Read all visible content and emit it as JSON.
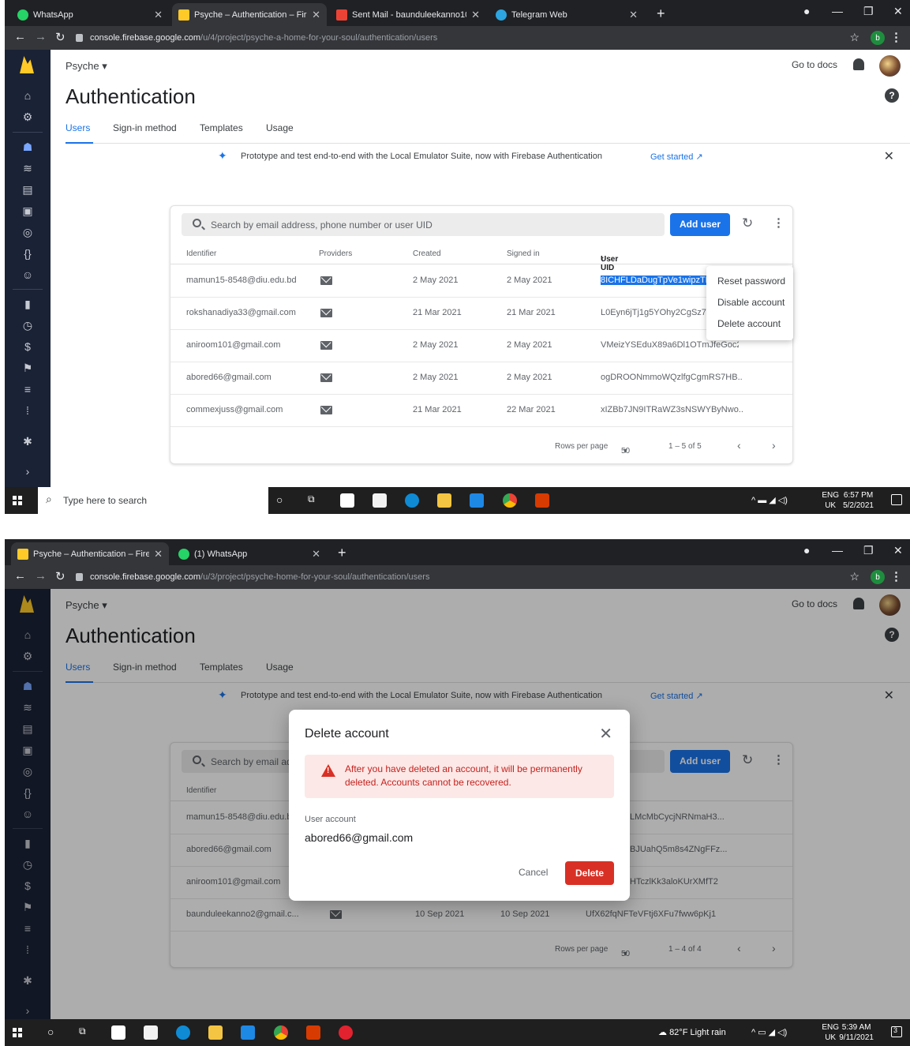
{
  "screenshot_1": {
    "tabs": [
      {
        "label": "WhatsApp",
        "color": "#25d366"
      },
      {
        "label": "Psyche – Authentication – Fireba",
        "color": "#ffca28"
      },
      {
        "label": "Sent Mail - baunduleekanno10@",
        "color": "#ea4335"
      },
      {
        "label": "Telegram Web",
        "color": "#2ca5e0"
      }
    ],
    "url": {
      "host": "console.firebase.google.com",
      "path": "/u/4/project/psyche-a-home-for-your-soul/authentication/users"
    },
    "profile_initial": "b",
    "console": {
      "project": "Psyche",
      "go_to_docs": "Go to docs",
      "page_title": "Authentication",
      "tabs": [
        "Users",
        "Sign-in method",
        "Templates",
        "Usage"
      ],
      "banner_text": "Prototype and test end-to-end with the Local Emulator Suite, now with Firebase Authentication",
      "banner_link": "Get started"
    },
    "users": {
      "search_placeholder": "Search by email address, phone number or user UID",
      "add_user": "Add user",
      "columns": [
        "Identifier",
        "Providers",
        "Created",
        "Signed in",
        "User UID"
      ],
      "rows": [
        {
          "identifier": "mamun15-8548@diu.edu.bd",
          "created": "2 May 2021",
          "signed_in": "2 May 2021",
          "uid": "8ICHFLDaDugTpVe1wipzTH"
        },
        {
          "identifier": "rokshanadiya33@gmail.com",
          "created": "21 Mar 2021",
          "signed_in": "21 Mar 2021",
          "uid": "L0Eyn6jTj1g5YOhy2CgSz7Il"
        },
        {
          "identifier": "aniroom101@gmail.com",
          "created": "2 May 2021",
          "signed_in": "2 May 2021",
          "uid": "VMeizYSEduX89a6Dl1OTmJfeGoc2"
        },
        {
          "identifier": "abored66@gmail.com",
          "created": "2 May 2021",
          "signed_in": "2 May 2021",
          "uid": "ogDROONmmoWQzlfgCgmRS7HB..."
        },
        {
          "identifier": "commexjuss@gmail.com",
          "created": "21 Mar 2021",
          "signed_in": "22 Mar 2021",
          "uid": "xIZBb7JN9ITRaWZ3sNSWYByNwo..."
        }
      ],
      "rows_per_page_label": "Rows per page",
      "rows_per_page": "50",
      "range": "1 – 5 of 5"
    },
    "context_menu": [
      "Reset password",
      "Disable account",
      "Delete account"
    ],
    "taskbar": {
      "search": "Type here to search",
      "lang": "ENG",
      "region": "UK",
      "time": "6:57 PM",
      "date": "5/2/2021"
    }
  },
  "screenshot_2": {
    "tabs": [
      {
        "label": "Psyche – Authentication – Fireba",
        "color": "#ffca28"
      },
      {
        "label": "(1) WhatsApp",
        "color": "#25d366"
      }
    ],
    "url": {
      "host": "console.firebase.google.com",
      "path": "/u/3/project/psyche-home-for-your-soul/authentication/users"
    },
    "profile_initial": "b",
    "console": {
      "project": "Psyche",
      "go_to_docs": "Go to docs",
      "page_title": "Authentication",
      "tabs": [
        "Users",
        "Sign-in method",
        "Templates",
        "Usage"
      ],
      "banner_text": "Prototype and test end-to-end with the Local Emulator Suite, now with Firebase Authentication",
      "banner_link": "Get started"
    },
    "users": {
      "search_placeholder": "Search by email ad",
      "add_user": "Add user",
      "identifier_header": "Identifier",
      "rows": [
        {
          "identifier": "mamun15-8548@diu.edu.b",
          "uid": "LMcMbCycjNRNmaH3..."
        },
        {
          "identifier": "abored66@gmail.com",
          "uid": "BJUahQ5m8s4ZNgFFz..."
        },
        {
          "identifier": "aniroom101@gmail.com",
          "uid": "HTczlKk3aloKUrXMfT2"
        },
        {
          "identifier": "baunduleekanno2@gmail.c...",
          "created": "10 Sep 2021",
          "signed_in": "10 Sep 2021",
          "uid": "UfX62fqNFTeVFtj6XFu7fww6pKj1"
        }
      ],
      "rows_per_page_label": "Rows per page",
      "rows_per_page": "50",
      "range": "1 – 4 of 4"
    },
    "dialog": {
      "title": "Delete account",
      "warning": "After you have deleted an account, it will be permanently deleted. Accounts cannot be recovered.",
      "label": "User account",
      "value": "abored66@gmail.com",
      "cancel": "Cancel",
      "delete": "Delete"
    },
    "taskbar": {
      "weather": "82°F  Light rain",
      "lang": "ENG",
      "region": "UK",
      "time": "5:39 AM",
      "date": "9/11/2021",
      "notif_count": "3"
    }
  }
}
